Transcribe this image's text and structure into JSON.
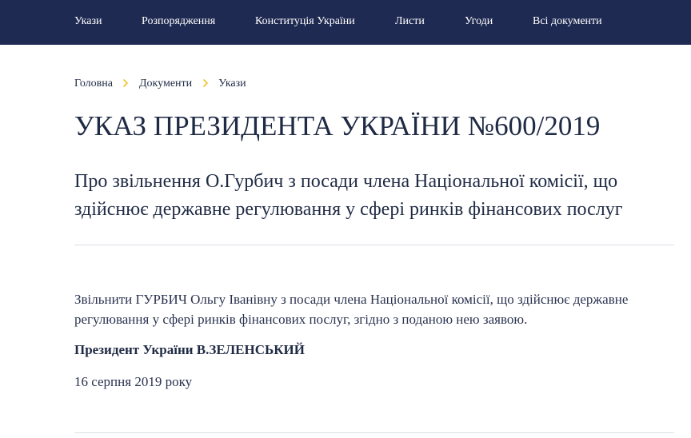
{
  "nav": {
    "items": [
      {
        "label": "Укази"
      },
      {
        "label": "Розпорядження"
      },
      {
        "label": "Конституція України"
      },
      {
        "label": "Листи"
      },
      {
        "label": "Угоди"
      },
      {
        "label": "Всі документи"
      }
    ]
  },
  "breadcrumb": {
    "items": [
      "Головна",
      "Документи",
      "Укази"
    ]
  },
  "document": {
    "title": "УКАЗ ПРЕЗИДЕНТА УКРАЇНИ №600/2019",
    "subtitle": "Про звільнення О.Гурбич з посади члена Національної комісії, що здійснює державне регулювання у сфері ринків фінансових послуг",
    "body": "Звільнити ГУРБИЧ Ольгу Іванівну з посади члена Національної комісії, що здійснює державне регулювання у сфері ринків фінансових послуг, згідно з поданою нею заявою.",
    "signature": "Президент України В.ЗЕЛЕНСЬКИЙ",
    "date": "16 серпня 2019 року"
  },
  "colors": {
    "nav_background": "#1f2a52",
    "text": "#1f2a44",
    "divider": "#dcdfe6",
    "breadcrumb_chevron": "#f2c12e"
  },
  "icons": {
    "breadcrumb_separator": "chevron-right-icon"
  }
}
